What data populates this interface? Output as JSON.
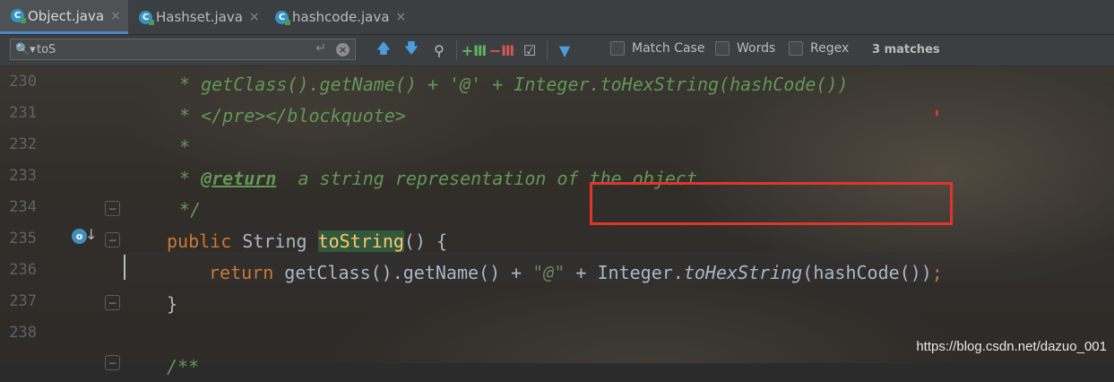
{
  "tabs": [
    {
      "label": "Object.java",
      "active": true,
      "close": "×"
    },
    {
      "label": "Hashset.java",
      "active": false,
      "close": "×"
    },
    {
      "label": "hashcode.java",
      "active": false,
      "close": "×"
    }
  ],
  "search": {
    "value": "toS",
    "match_case_label": "Match Case",
    "words_label": "Words",
    "regex_label": "Regex",
    "matches_text": "3 matches"
  },
  "gutter": {
    "line_numbers": [
      "230",
      "231",
      "232",
      "233",
      "234",
      "235",
      "236",
      "237",
      "238"
    ]
  },
  "code": {
    "l230": "* getClass().getName() + '@' + Integer.toHexString(hashCode())",
    "l231": "* </pre></blockquote>",
    "l232": "*",
    "l233_star": "* ",
    "l233_tag": "@return",
    "l233_text": "  a string representation of the object.",
    "l234": "*/",
    "l235_kw": "public ",
    "l235_type": "String ",
    "l235_name": "toString",
    "l235_rest": "() {",
    "l236_kw": "return ",
    "l236_a": "getClass().getName() + ",
    "l236_str": "\"@\"",
    "l236_b": " + Integer.",
    "l236_italic": "toHexString",
    "l236_c": "(hashCode())",
    "l236_semi": ";",
    "l237": "}",
    "l239": "/**"
  },
  "watermark": "https://blog.csdn.net/dazuo_001",
  "colors": {
    "keyword": "#cc7832",
    "comment": "#629755",
    "method": "#ffc66d",
    "highlight": "#32593d",
    "annotation_box": "#e0352b"
  }
}
